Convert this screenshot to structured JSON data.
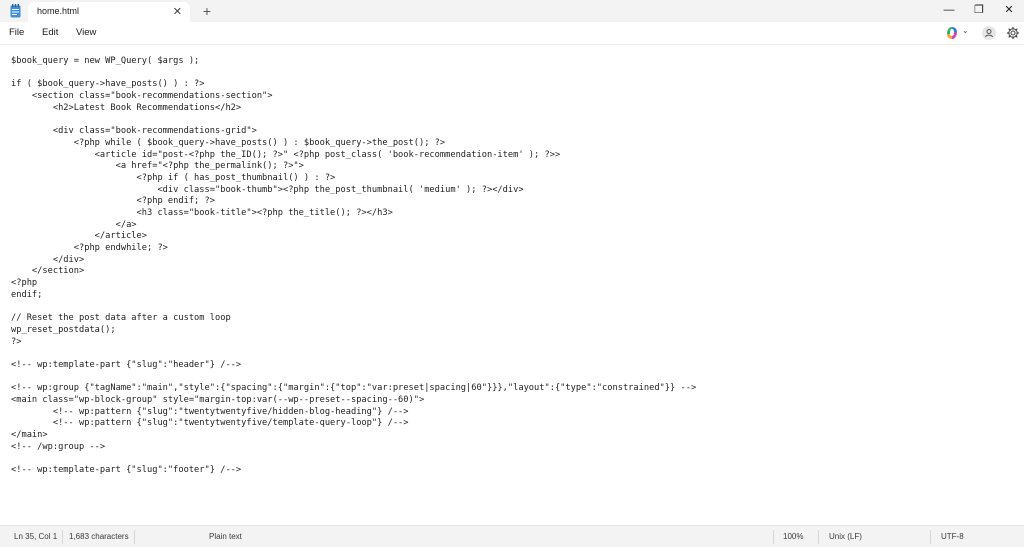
{
  "tab": {
    "title": "home.html",
    "close_symbol": "✕",
    "new_tab_symbol": "+"
  },
  "window_controls": {
    "minimize": "—",
    "maximize": "❐",
    "close": "✕"
  },
  "menu": {
    "file": "File",
    "edit": "Edit",
    "view": "View"
  },
  "code_lines": [
    "$book_query = new WP_Query( $args );",
    "",
    "if ( $book_query->have_posts() ) : ?>",
    "    <section class=\"book-recommendations-section\">",
    "        <h2>Latest Book Recommendations</h2>",
    "",
    "        <div class=\"book-recommendations-grid\">",
    "            <?php while ( $book_query->have_posts() ) : $book_query->the_post(); ?>",
    "                <article id=\"post-<?php the_ID(); ?>\" <?php post_class( 'book-recommendation-item' ); ?>>",
    "                    <a href=\"<?php the_permalink(); ?>\">",
    "                        <?php if ( has_post_thumbnail() ) : ?>",
    "                            <div class=\"book-thumb\"><?php the_post_thumbnail( 'medium' ); ?></div>",
    "                        <?php endif; ?>",
    "                        <h3 class=\"book-title\"><?php the_title(); ?></h3>",
    "                    </a>",
    "                </article>",
    "            <?php endwhile; ?>",
    "        </div>",
    "    </section>",
    "<?php",
    "endif;",
    "",
    "// Reset the post data after a custom loop",
    "wp_reset_postdata();",
    "?>",
    "",
    "<!-- wp:template-part {\"slug\":\"header\"} /-->",
    "",
    "<!-- wp:group {\"tagName\":\"main\",\"style\":{\"spacing\":{\"margin\":{\"top\":\"var:preset|spacing|60\"}}},\"layout\":{\"type\":\"constrained\"}} -->",
    "<main class=\"wp-block-group\" style=\"margin-top:var(--wp--preset--spacing--60)\">",
    "        <!-- wp:pattern {\"slug\":\"twentytwentyfive/hidden-blog-heading\"} /-->",
    "        <!-- wp:pattern {\"slug\":\"twentytwentyfive/template-query-loop\"} /-->",
    "</main>",
    "<!-- /wp:group -->",
    "",
    "<!-- wp:template-part {\"slug\":\"footer\"} /-->"
  ],
  "status": {
    "position": "Ln 35, Col 1",
    "characters": "1,683 characters",
    "format": "Plain text",
    "zoom": "100%",
    "line_ending": "Unix (LF)",
    "encoding": "UTF-8"
  },
  "icons": {
    "app": "notepad-icon",
    "copilot": "copilot-icon",
    "profile": "profile-icon",
    "settings": "gear-icon"
  },
  "colors": {
    "titlebar": "#f3f3f3",
    "editor": "#ffffff",
    "accent": "#3a7bd5"
  }
}
